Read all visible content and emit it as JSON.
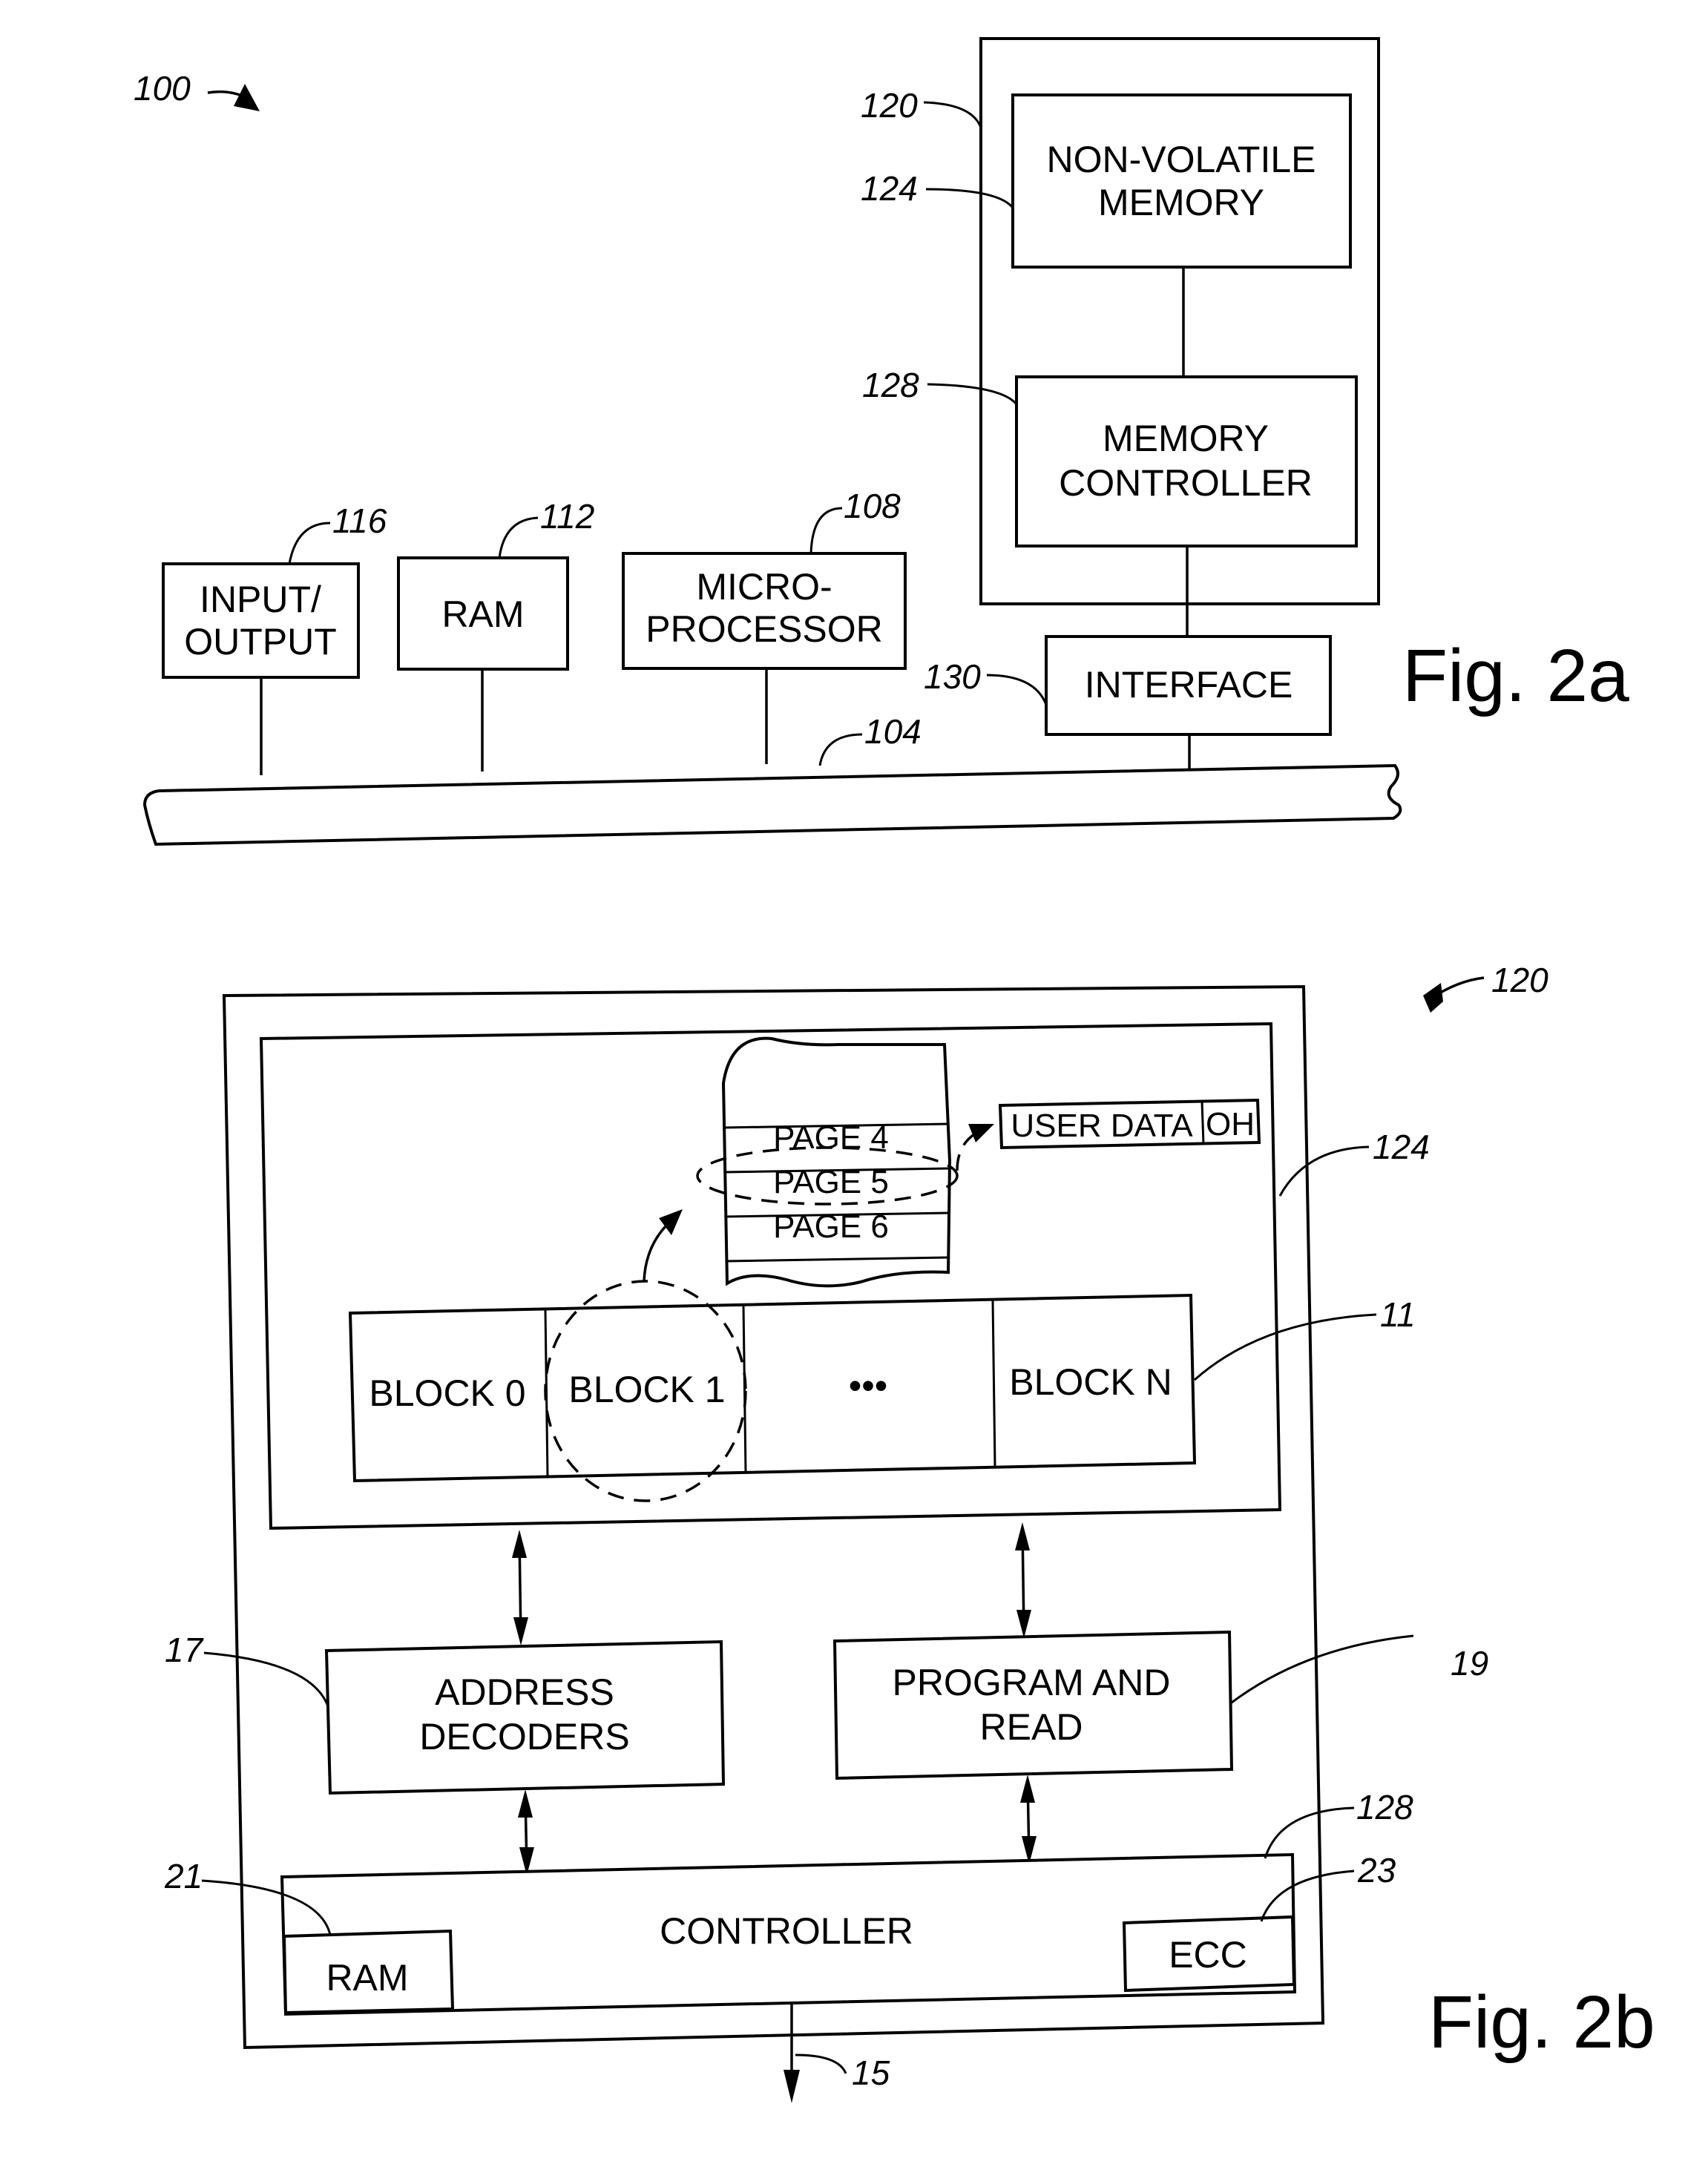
{
  "fig2a": {
    "caption": "Fig. 2a",
    "system_ref": "100",
    "bus_ref": "104",
    "blocks": {
      "io": {
        "line1": "INPUT/",
        "line2": "OUTPUT",
        "ref": "116"
      },
      "ram": {
        "label": "RAM",
        "ref": "112"
      },
      "cpu": {
        "line1": "MICRO-",
        "line2": "PROCESSOR",
        "ref": "108"
      },
      "interface": {
        "label": "INTERFACE",
        "ref": "130"
      },
      "storage_ref": "120",
      "nvm": {
        "line1": "NON-VOLATILE",
        "line2": "MEMORY",
        "ref": "124"
      },
      "memctl": {
        "line1": "MEMORY",
        "line2": "CONTROLLER",
        "ref": "128"
      }
    }
  },
  "fig2b": {
    "caption": "Fig. 2b",
    "system_ref": "120",
    "memory_ref": "124",
    "blocks_ref": "11",
    "pages": [
      "PAGE 4",
      "PAGE 5",
      "PAGE 6"
    ],
    "page_format": {
      "user_data": "USER DATA",
      "overhead": "OH"
    },
    "memory_blocks": [
      "BLOCK 0",
      "BLOCK 1",
      "•••",
      "BLOCK N"
    ],
    "address_decoders": {
      "line1": "ADDRESS",
      "line2": "DECODERS",
      "ref": "17"
    },
    "program_read": {
      "line1": "PROGRAM AND",
      "line2": "READ",
      "ref": "19"
    },
    "controller": {
      "label": "CONTROLLER",
      "ref": "128"
    },
    "ctl_ram": {
      "label": "RAM",
      "ref": "21"
    },
    "ecc": {
      "label": "ECC",
      "ref": "23"
    },
    "output_ref": "15"
  }
}
